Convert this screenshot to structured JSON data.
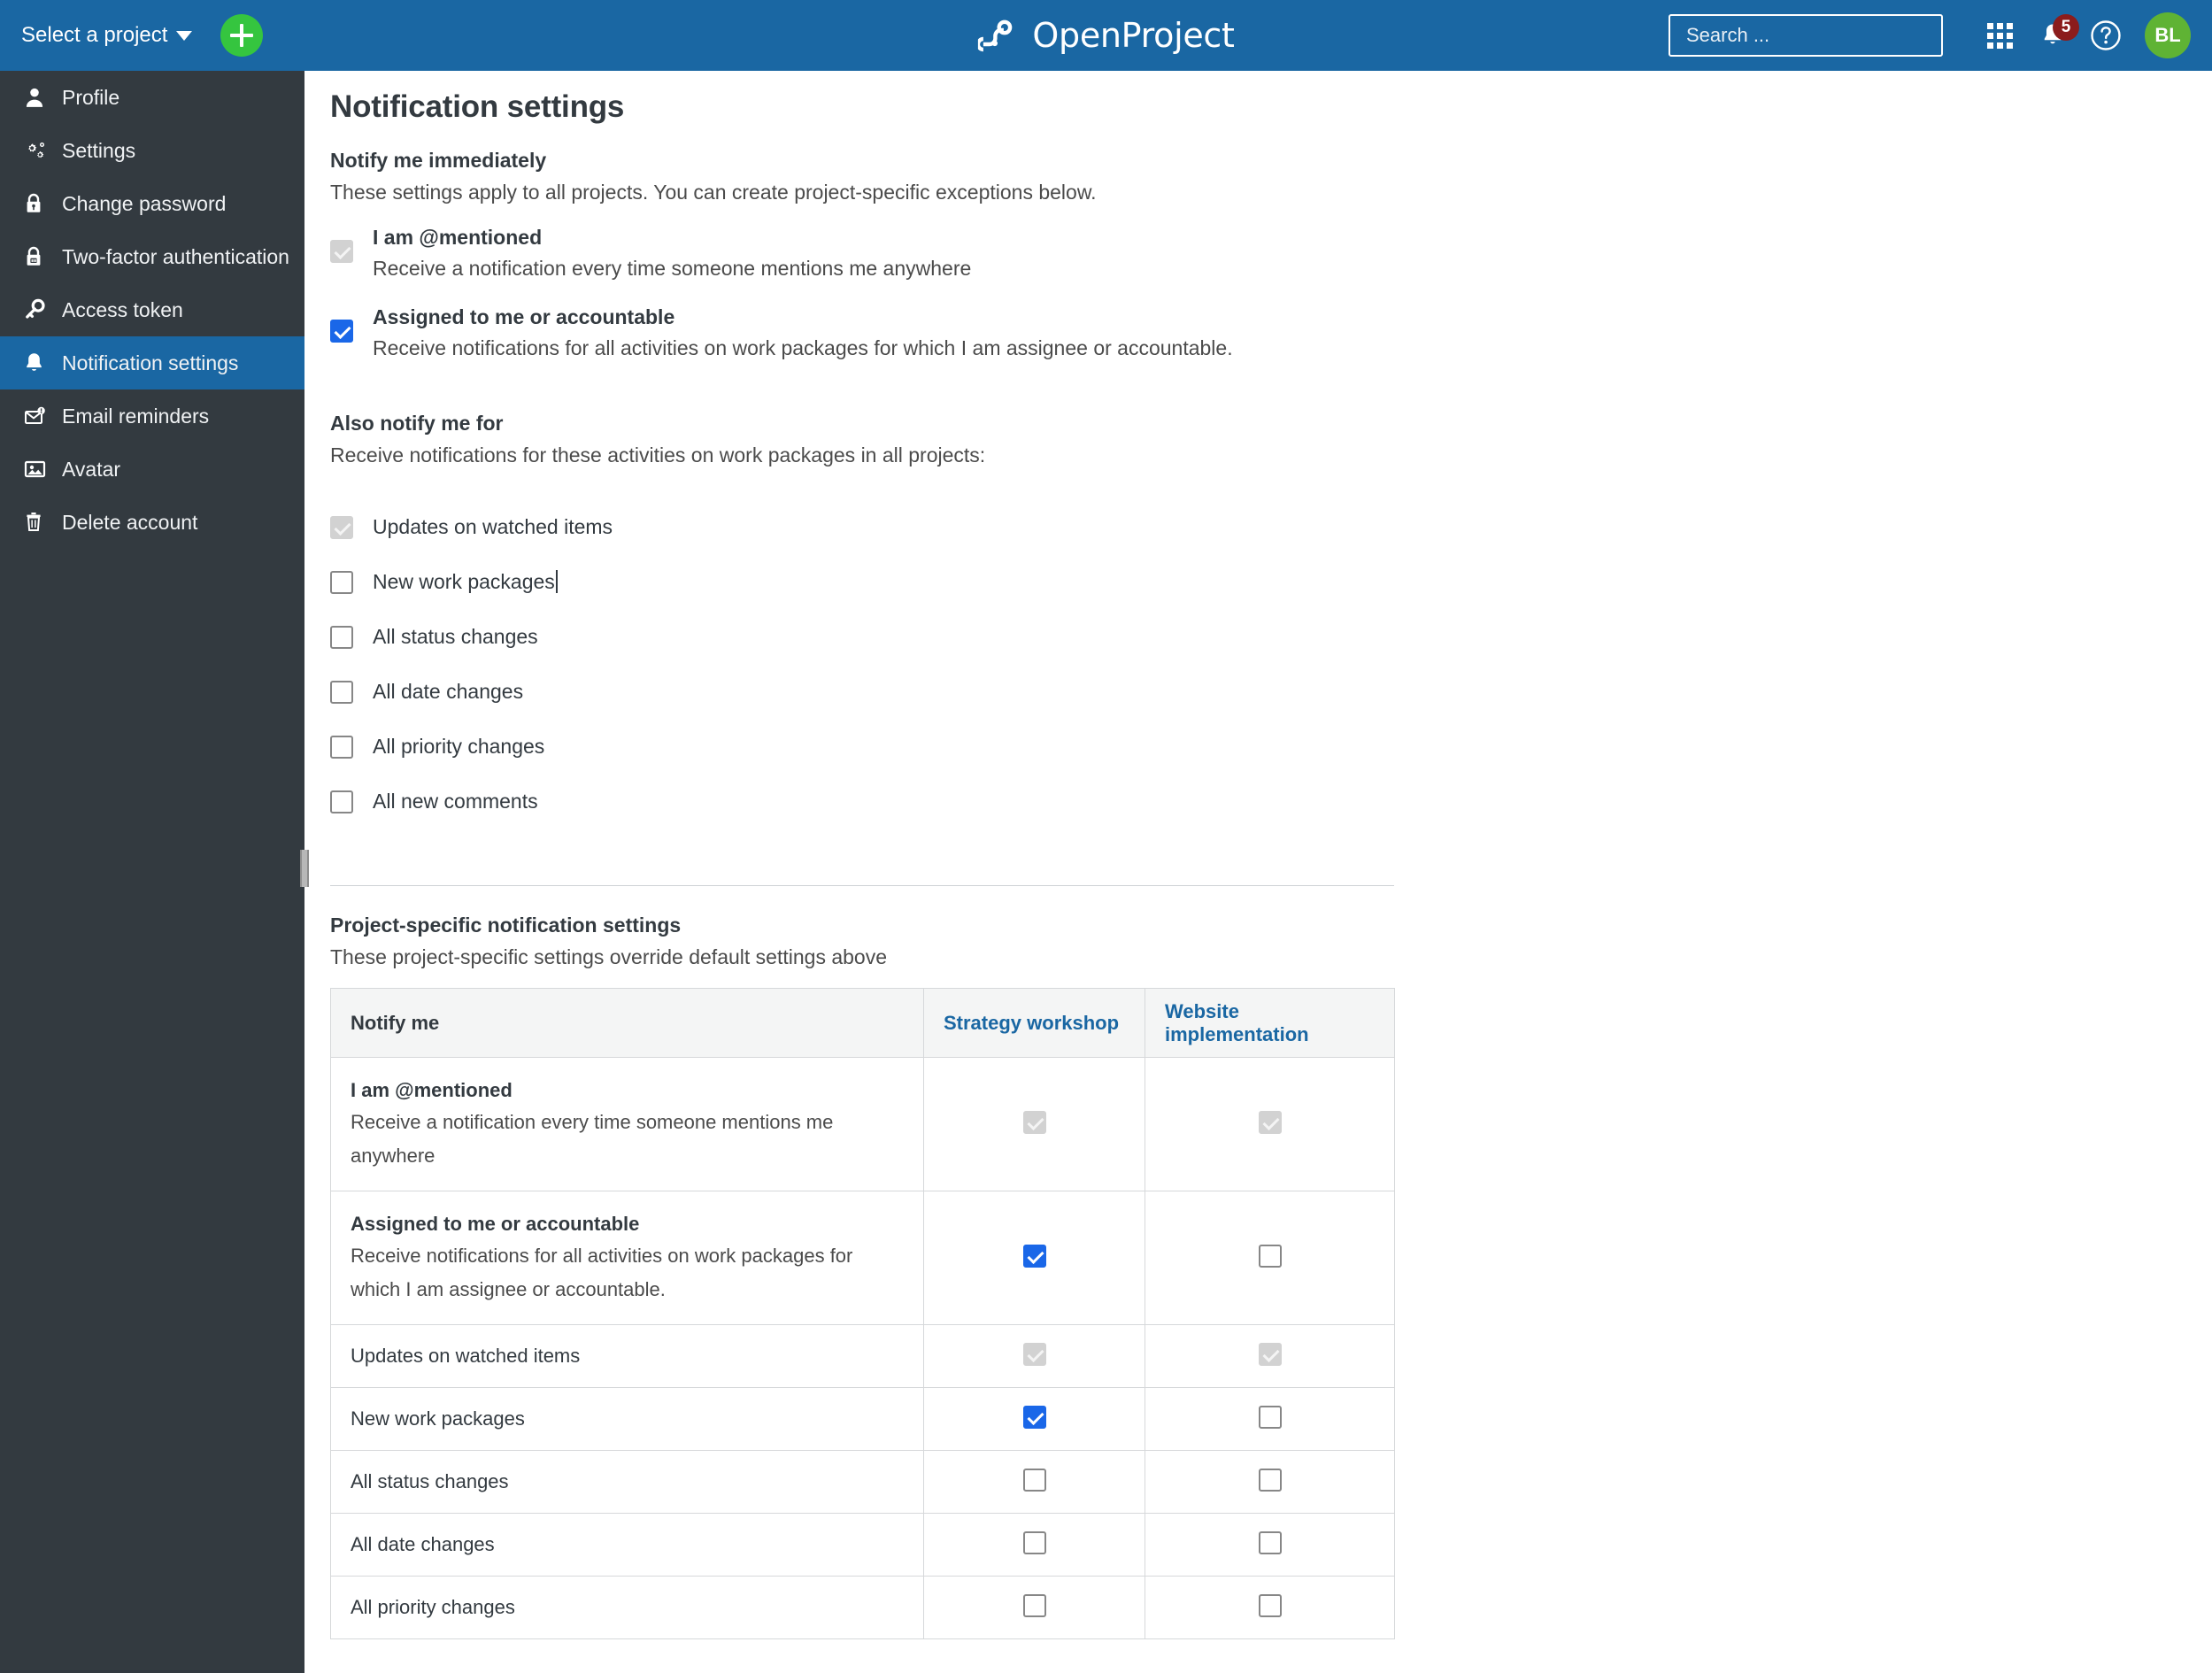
{
  "header": {
    "project_select_label": "Select a project",
    "add_button_name": "add-button",
    "logo_text": "OpenProject",
    "search_placeholder": "Search ...",
    "search_value": "",
    "notification_count": "5",
    "help_label": "?",
    "avatar_initials": "BL"
  },
  "sidebar": {
    "items": [
      {
        "label": "Profile",
        "icon": "user-icon",
        "active": false
      },
      {
        "label": "Settings",
        "icon": "gear-icon",
        "active": false
      },
      {
        "label": "Change password",
        "icon": "lock-icon",
        "active": false
      },
      {
        "label": "Two-factor authentication",
        "icon": "lock-shield-icon",
        "active": false
      },
      {
        "label": "Access token",
        "icon": "key-icon",
        "active": false
      },
      {
        "label": "Notification settings",
        "icon": "bell-icon",
        "active": true
      },
      {
        "label": "Email reminders",
        "icon": "envelope-clock-icon",
        "active": false
      },
      {
        "label": "Avatar",
        "icon": "image-icon",
        "active": false
      },
      {
        "label": "Delete account",
        "icon": "trash-icon",
        "active": false
      }
    ]
  },
  "main": {
    "page_title": "Notification settings",
    "immediate": {
      "heading": "Notify me immediately",
      "description": "These settings apply to all projects. You can create project-specific exceptions below.",
      "options": [
        {
          "title": "I am @mentioned",
          "description": "Receive a notification every time someone mentions me anywhere",
          "state": "disabled-checked"
        },
        {
          "title": "Assigned to me or accountable",
          "description": "Receive notifications for all activities on work packages for which I am assignee or accountable.",
          "state": "checked"
        }
      ]
    },
    "also_notify": {
      "heading": "Also notify me for",
      "description": "Receive notifications for these activities on work packages in all projects:",
      "options": [
        {
          "label": "Updates on watched items",
          "state": "disabled-checked",
          "caret": false
        },
        {
          "label": "New work packages",
          "state": "unchecked",
          "caret": true
        },
        {
          "label": "All status changes",
          "state": "unchecked",
          "caret": false
        },
        {
          "label": "All date changes",
          "state": "unchecked",
          "caret": false
        },
        {
          "label": "All priority changes",
          "state": "unchecked",
          "caret": false
        },
        {
          "label": "All new comments",
          "state": "unchecked",
          "caret": false
        }
      ]
    },
    "project_specific": {
      "heading": "Project-specific notification settings",
      "description": "These project-specific settings override default settings above",
      "table": {
        "columns": [
          "Notify me",
          "Strategy workshop",
          "Website implementation"
        ],
        "rows": [
          {
            "title": "I am @mentioned",
            "description": "Receive a notification every time someone mentions me anywhere",
            "two_line": true,
            "values": [
              "disabled-checked",
              "disabled-checked"
            ]
          },
          {
            "title": "Assigned to me or accountable",
            "description": "Receive notifications for all activities on work packages for which I am assignee or accountable.",
            "two_line": true,
            "values": [
              "checked",
              "unchecked"
            ]
          },
          {
            "title": "Updates on watched items",
            "description": "",
            "two_line": false,
            "values": [
              "disabled-checked",
              "disabled-checked"
            ]
          },
          {
            "title": "New work packages",
            "description": "",
            "two_line": false,
            "values": [
              "checked",
              "unchecked"
            ]
          },
          {
            "title": "All status changes",
            "description": "",
            "two_line": false,
            "values": [
              "unchecked",
              "unchecked"
            ]
          },
          {
            "title": "All date changes",
            "description": "",
            "two_line": false,
            "values": [
              "unchecked",
              "unchecked"
            ]
          },
          {
            "title": "All priority changes",
            "description": "",
            "two_line": false,
            "values": [
              "unchecked",
              "unchecked"
            ]
          }
        ]
      }
    }
  },
  "colors": {
    "header_blue": "#1a67a3",
    "sidebar_dark": "#333a40",
    "accent_checkbox": "#1a67e8",
    "add_green": "#35c53f",
    "avatar_green": "#5fb334",
    "badge_red": "#8b1c1c",
    "link_blue": "#1a67a3"
  }
}
